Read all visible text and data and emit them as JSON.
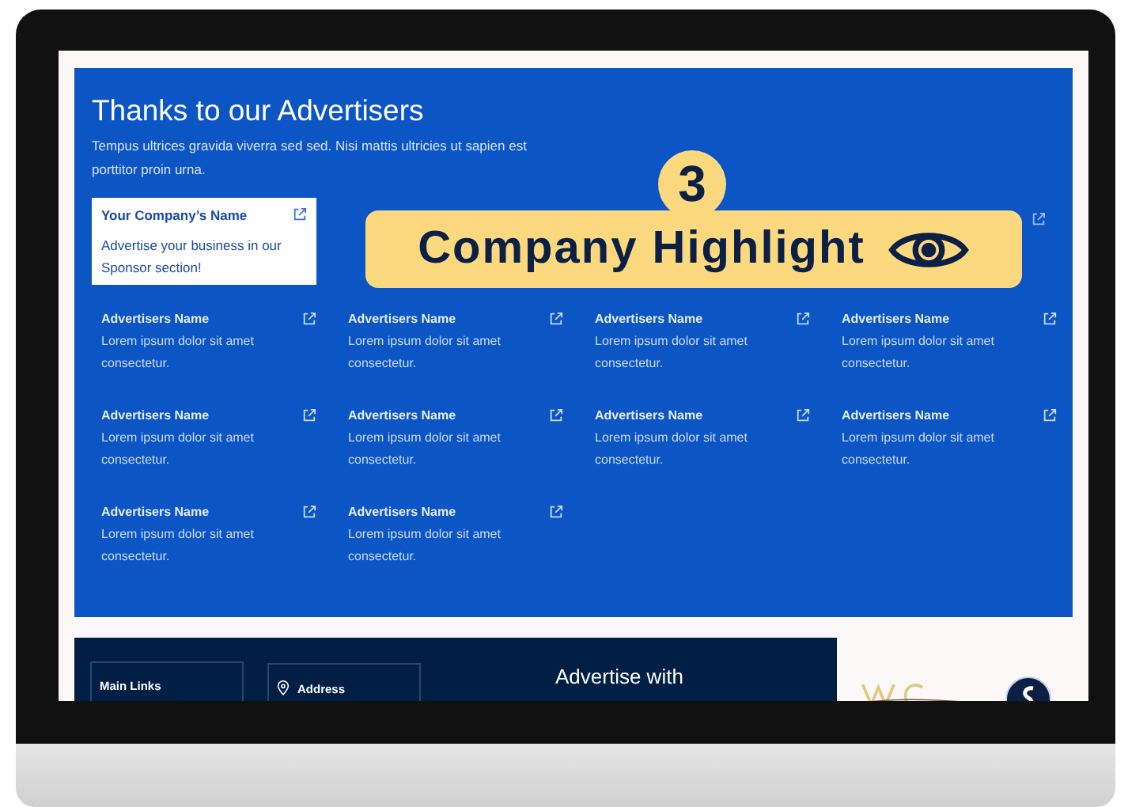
{
  "section": {
    "title": "Thanks to our Advertisers",
    "description": "Tempus ultrices gravida viverra sed sed. Nisi mattis ultricies ut sapien est porttitor proin urna."
  },
  "featured": {
    "name": "Your Company’s Name",
    "text": "Advertise your business in our Sponsor section!"
  },
  "highlight": {
    "step": "3",
    "label": "Company Highlight"
  },
  "advertisers": [
    {
      "name": "Advertisers Name",
      "text": "Lorem ipsum dolor sit amet consectetur."
    },
    {
      "name": "Advertisers Name",
      "text": "Lorem ipsum dolor sit amet consectetur."
    },
    {
      "name": "Advertisers Name",
      "text": "Lorem ipsum dolor sit amet consectetur."
    },
    {
      "name": "Advertisers Name",
      "text": "Lorem ipsum dolor sit amet consectetur."
    },
    {
      "name": "Advertisers Name",
      "text": "Lorem ipsum dolor sit amet consectetur."
    },
    {
      "name": "Advertisers Name",
      "text": "Lorem ipsum dolor sit amet consectetur."
    },
    {
      "name": "Advertisers Name",
      "text": "Lorem ipsum dolor sit amet consectetur."
    },
    {
      "name": "Advertisers Name",
      "text": "Lorem ipsum dolor sit amet consectetur."
    },
    {
      "name": "Advertisers Name",
      "text": "Lorem ipsum dolor sit amet consectetur."
    },
    {
      "name": "Advertisers Name",
      "text": "Lorem ipsum dolor sit amet consectetur."
    }
  ],
  "footer": {
    "links_title": "Main Links",
    "address_title": "Address",
    "advertise": "Advertise with"
  }
}
